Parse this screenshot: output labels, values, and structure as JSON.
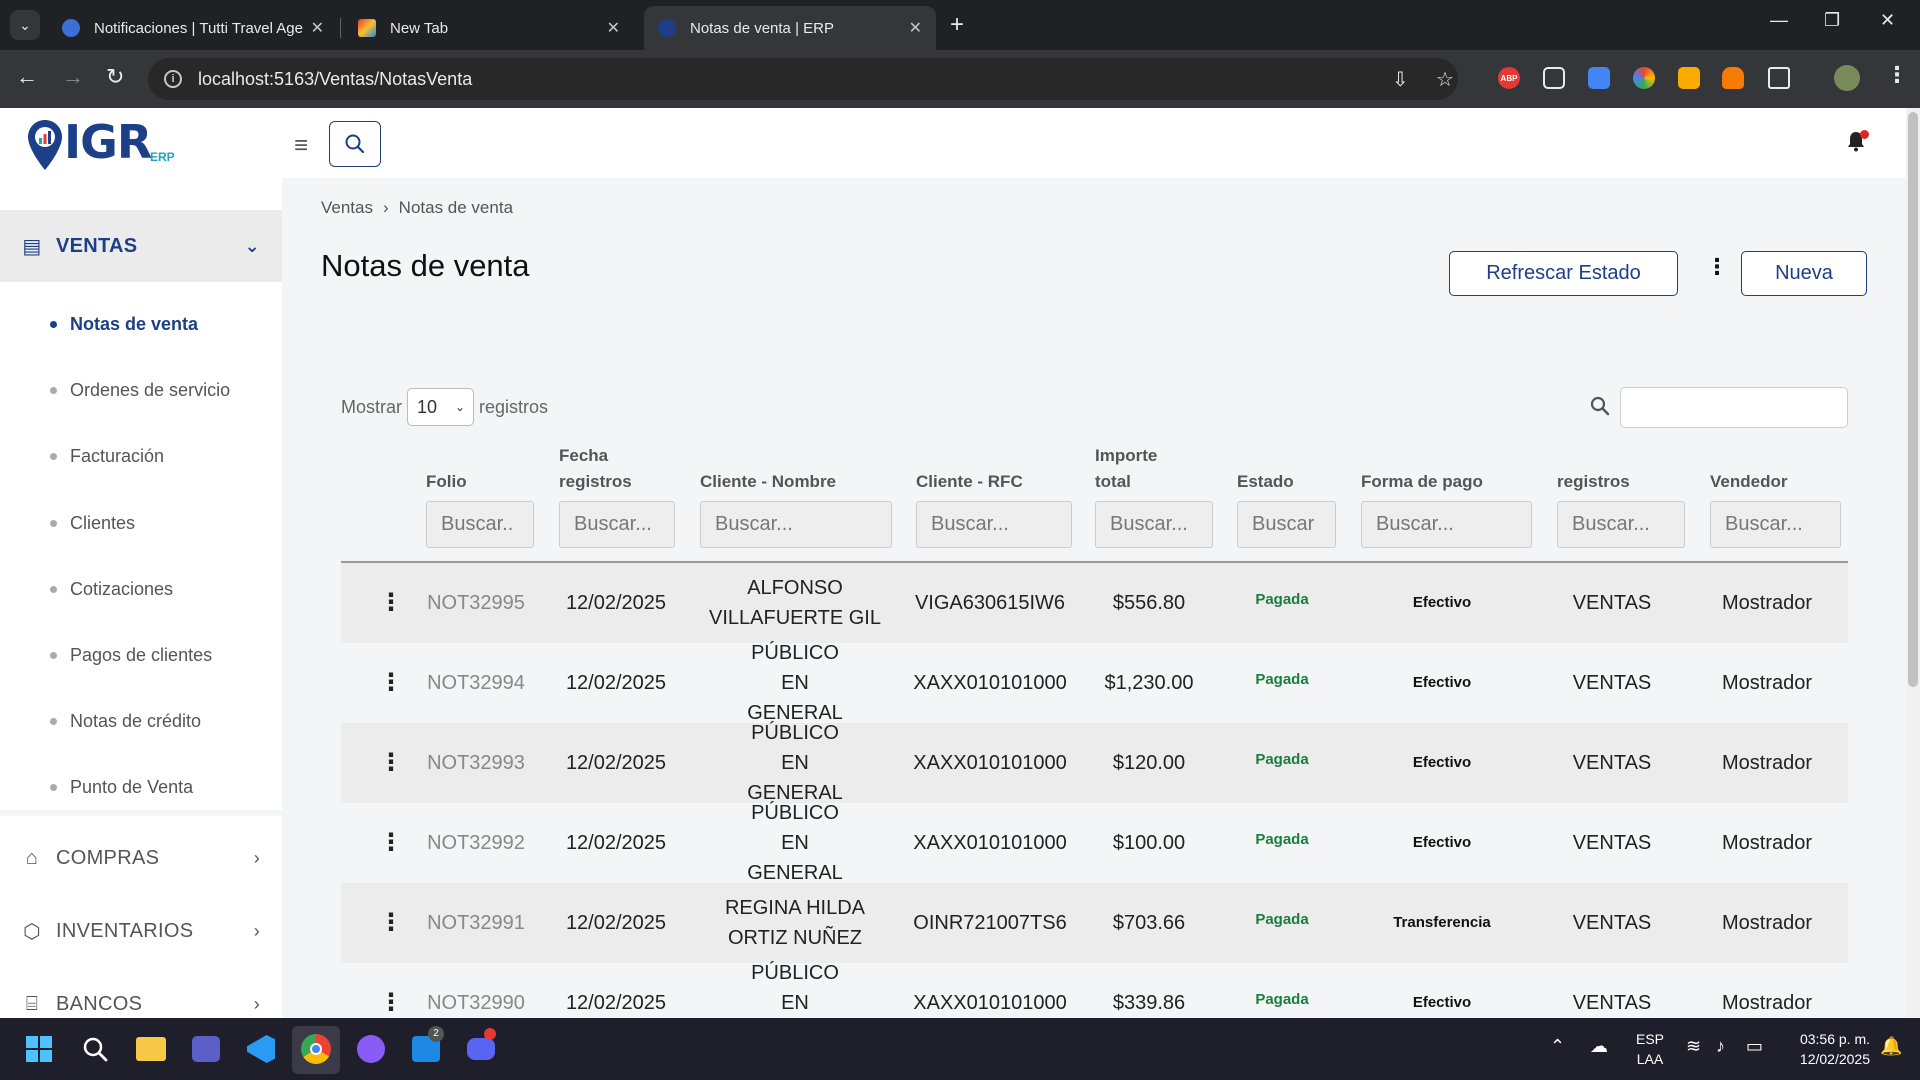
{
  "browser": {
    "tabs": [
      {
        "title": "Notificaciones | Tutti Travel Age",
        "close": "✕"
      },
      {
        "title": "New Tab",
        "close": "✕"
      },
      {
        "title": "Notas de venta | ERP",
        "close": "✕"
      }
    ],
    "new_tab": "+",
    "url": "localhost:5163/Ventas/NotasVenta",
    "ext_abp": "ABP"
  },
  "app": {
    "logo_text": "IGR",
    "logo_sub": "ERP"
  },
  "sidebar": {
    "open_section": "VENTAS",
    "items": [
      {
        "label": "Notas de venta",
        "active": true
      },
      {
        "label": "Ordenes de servicio"
      },
      {
        "label": "Facturación"
      },
      {
        "label": "Clientes"
      },
      {
        "label": "Cotizaciones"
      },
      {
        "label": "Pagos de clientes"
      },
      {
        "label": "Notas de crédito"
      },
      {
        "label": "Punto de Venta"
      }
    ],
    "sections": [
      {
        "label": "COMPRAS",
        "icon": "store-icon"
      },
      {
        "label": "INVENTARIOS",
        "icon": "box-icon"
      },
      {
        "label": "BANCOS",
        "icon": "bank-icon"
      }
    ]
  },
  "page": {
    "breadcrumb": [
      "Ventas",
      "Notas de venta"
    ],
    "title": "Notas de venta",
    "refresh_label": "Refrescar Estado",
    "new_label": "Nueva"
  },
  "table": {
    "length_prefix": "Mostrar",
    "length_value": "10",
    "length_suffix": "registros",
    "headers": [
      "Folio",
      "Fecha registros",
      "Cliente - Nombre",
      "Cliente - RFC",
      "Importe total",
      "Estado",
      "Forma de pago",
      "registros",
      "Vendedor"
    ],
    "filters": [
      "Buscar..",
      "Buscar...",
      "Buscar...",
      "Buscar...",
      "Buscar...",
      "Buscar",
      "Buscar...",
      "Buscar...",
      "Buscar..."
    ],
    "rows": [
      {
        "folio": "NOT32995",
        "fecha": "12/02/2025",
        "cliente": "ALFONSO VILLAFUERTE GIL",
        "rfc": "VIGA630615IW6",
        "importe": "$556.80",
        "estado": "Pagada",
        "pago": "Efectivo",
        "registros": "VENTAS",
        "vendedor": "Mostrador"
      },
      {
        "folio": "NOT32994",
        "fecha": "12/02/2025",
        "cliente": "PÚBLICO EN GENERAL",
        "rfc": "XAXX010101000",
        "importe": "$1,230.00",
        "estado": "Pagada",
        "pago": "Efectivo",
        "registros": "VENTAS",
        "vendedor": "Mostrador"
      },
      {
        "folio": "NOT32993",
        "fecha": "12/02/2025",
        "cliente": "PÚBLICO EN GENERAL",
        "rfc": "XAXX010101000",
        "importe": "$120.00",
        "estado": "Pagada",
        "pago": "Efectivo",
        "registros": "VENTAS",
        "vendedor": "Mostrador"
      },
      {
        "folio": "NOT32992",
        "fecha": "12/02/2025",
        "cliente": "PÚBLICO EN GENERAL",
        "rfc": "XAXX010101000",
        "importe": "$100.00",
        "estado": "Pagada",
        "pago": "Efectivo",
        "registros": "VENTAS",
        "vendedor": "Mostrador"
      },
      {
        "folio": "NOT32991",
        "fecha": "12/02/2025",
        "cliente": "REGINA HILDA ORTIZ NUÑEZ",
        "rfc": "OINR721007TS6",
        "importe": "$703.66",
        "estado": "Pagada",
        "pago": "Transferencia",
        "registros": "VENTAS",
        "vendedor": "Mostrador"
      },
      {
        "folio": "NOT32990",
        "fecha": "12/02/2025",
        "cliente": "PÚBLICO EN GENERAL",
        "rfc": "XAXX010101000",
        "importe": "$339.86",
        "estado": "Pagada",
        "pago": "Efectivo",
        "registros": "VENTAS",
        "vendedor": "Mostrador"
      }
    ]
  },
  "taskbar": {
    "lang": "ESP",
    "layout": "LAA",
    "time": "03:56 p. m.",
    "date": "12/02/2025",
    "badge_count": "2"
  },
  "colors": {
    "brand": "#1c3f87",
    "paid": "#1a7f3a"
  }
}
